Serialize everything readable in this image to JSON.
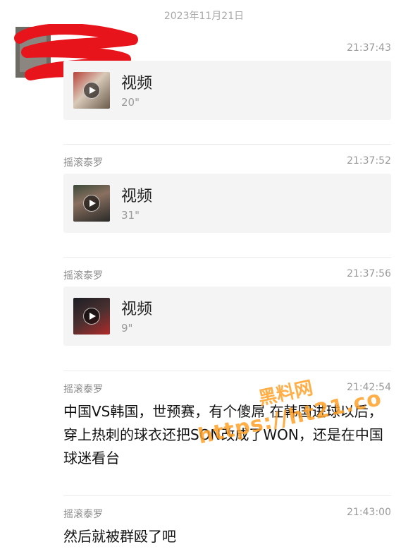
{
  "date_separator": "2023年11月21日",
  "colors": {
    "redaction": "#e8141c",
    "watermark": "#ffa028",
    "card_bg": "#f4f4f4"
  },
  "messages": [
    {
      "type": "video",
      "sender": "",
      "time": "21:37:43",
      "title": "视频",
      "duration": "20\"",
      "thumb_icon": "video-thumbnail-crowd"
    },
    {
      "type": "video",
      "sender": "摇滚泰罗",
      "time": "21:37:52",
      "title": "视频",
      "duration": "31\"",
      "thumb_icon": "video-thumbnail-crowd"
    },
    {
      "type": "video",
      "sender": "摇滚泰罗",
      "time": "21:37:56",
      "title": "视频",
      "duration": "9\"",
      "thumb_icon": "video-thumbnail-dark"
    },
    {
      "type": "text",
      "sender": "摇滚泰罗",
      "time": "21:42:54",
      "text": "中国VS韩国，世预赛，有个傻屌 在韩国进球以后，穿上热刺的球衣还把SON改成了WON，还是在中国球迷看台"
    },
    {
      "type": "text",
      "sender": "摇滚泰罗",
      "time": "21:43:00",
      "text": "然后就被群殴了吧"
    }
  ],
  "watermark": {
    "line1": "黑料网",
    "line2": "https://ht21.co"
  }
}
